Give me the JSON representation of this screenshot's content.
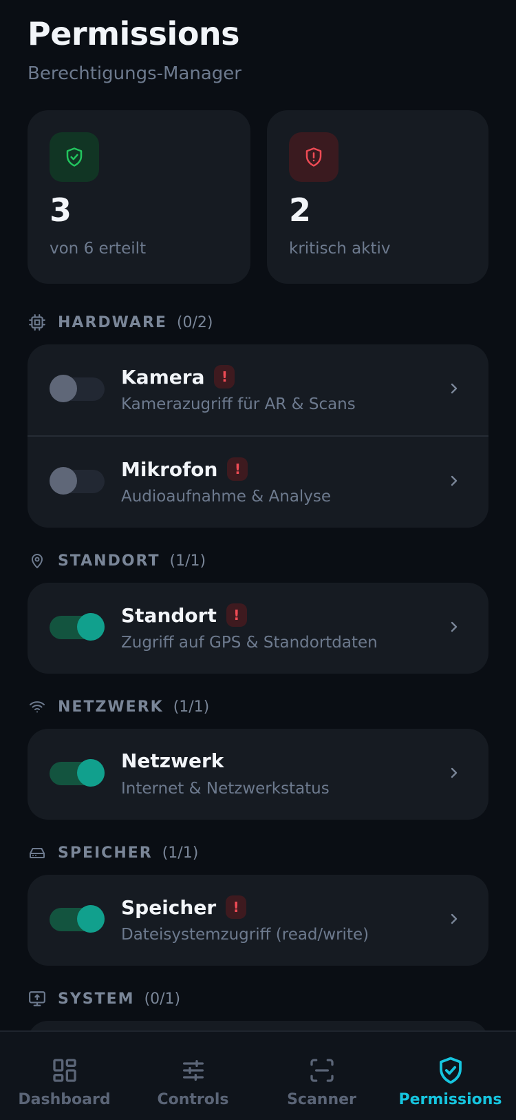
{
  "header": {
    "title": "Permissions",
    "subtitle": "Berechtigungs-Manager"
  },
  "stats": [
    {
      "value": "3",
      "label": "von 6 erteilt",
      "icon": "shield-check-icon",
      "color": "#22c55e"
    },
    {
      "value": "2",
      "label": "kritisch aktiv",
      "icon": "shield-alert-icon",
      "color": "#ef4b55"
    }
  ],
  "sections": {
    "hardware": {
      "title": "HARDWARE",
      "count": "(0/2)",
      "icon": "chip-icon",
      "items": [
        {
          "title": "Kamera",
          "desc": "Kamerazugriff für AR & Scans",
          "enabled": false,
          "critical": true,
          "warn": "!"
        },
        {
          "title": "Mikrofon",
          "desc": "Audioaufnahme & Analyse",
          "enabled": false,
          "critical": true,
          "warn": "!"
        }
      ]
    },
    "standort": {
      "title": "STANDORT",
      "count": "(1/1)",
      "icon": "map-pin-icon",
      "items": [
        {
          "title": "Standort",
          "desc": "Zugriff auf GPS & Standortdaten",
          "enabled": true,
          "critical": true,
          "warn": "!"
        }
      ]
    },
    "netzwerk": {
      "title": "NETZWERK",
      "count": "(1/1)",
      "icon": "wifi-icon",
      "items": [
        {
          "title": "Netzwerk",
          "desc": "Internet & Netzwerkstatus",
          "enabled": true,
          "critical": false
        }
      ]
    },
    "speicher": {
      "title": "SPEICHER",
      "count": "(1/1)",
      "icon": "hard-drive-icon",
      "items": [
        {
          "title": "Speicher",
          "desc": "Dateisystemzugriff (read/write)",
          "enabled": true,
          "critical": true,
          "warn": "!"
        }
      ]
    },
    "system": {
      "title": "SYSTEM",
      "count": "(0/1)",
      "icon": "monitor-icon"
    }
  },
  "nav": [
    {
      "label": "Dashboard",
      "icon": "grid-icon",
      "active": false
    },
    {
      "label": "Controls",
      "icon": "sliders-icon",
      "active": false
    },
    {
      "label": "Scanner",
      "icon": "scan-icon",
      "active": false
    },
    {
      "label": "Permissions",
      "icon": "shield-check-icon",
      "active": true
    }
  ],
  "colors": {
    "background": "#0a0e14",
    "card": "#161b22",
    "accent": "#16c5df",
    "toggle_on": "#11a08d",
    "warning": "#ef4b55",
    "success": "#22c55e"
  }
}
